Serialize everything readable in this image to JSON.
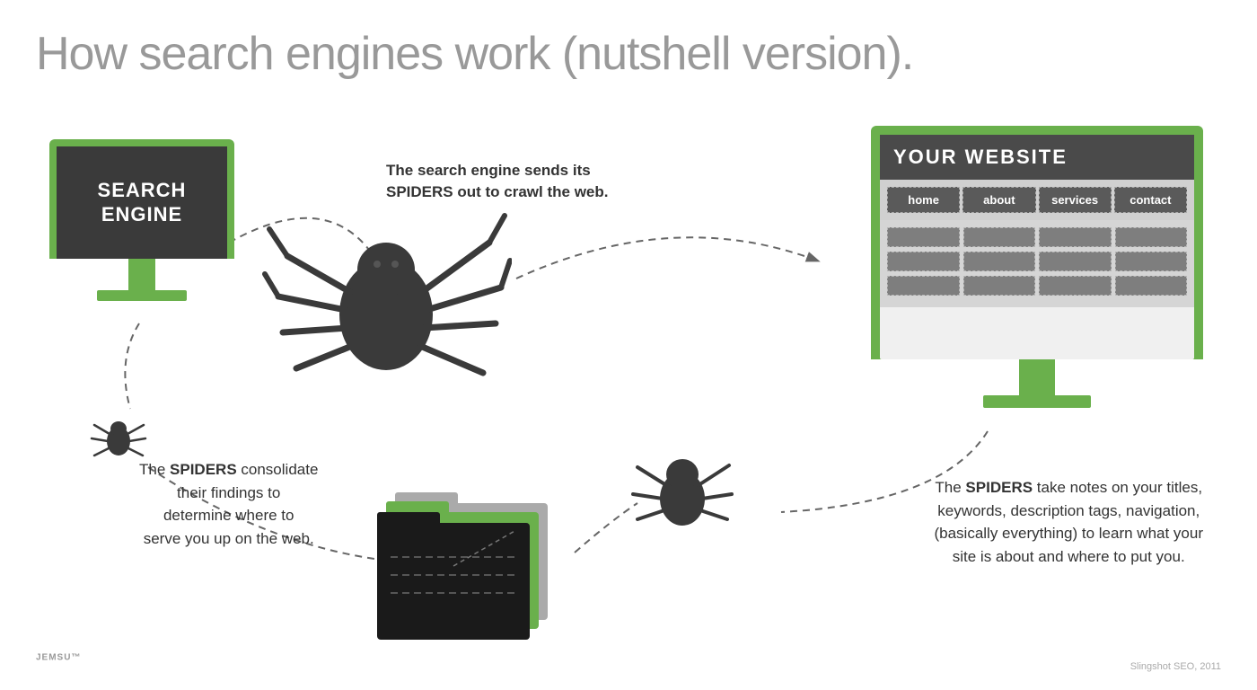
{
  "title": "How search engines work (nutshell version).",
  "search_engine": {
    "label_line1": "SEARCH",
    "label_line2": "ENGINE"
  },
  "your_website": {
    "title": "YOUR WEBSITE",
    "nav_items": [
      "home",
      "about",
      "services",
      "contact"
    ],
    "content_rows": 3,
    "content_cols": 4
  },
  "annotations": {
    "top": "The search engine sends its SPIDERS out to crawl the web.",
    "bottom_left": "The SPIDERS consolidate their findings to determine where to serve you up on the web.",
    "bottom_right": "The SPIDERS take notes on your titles, keywords, description tags, navigation, (basically everything) to learn what your site is about and where to put you."
  },
  "footer": {
    "brand": "JEMSU",
    "trademark": "™",
    "credit": "Slingshot SEO, 2011"
  },
  "colors": {
    "green": "#6ab04c",
    "dark_gray": "#4a4a4a",
    "mid_gray": "#5a5a5a",
    "light_gray": "#d0d0d0",
    "text_gray": "#333333",
    "title_gray": "#999999"
  }
}
